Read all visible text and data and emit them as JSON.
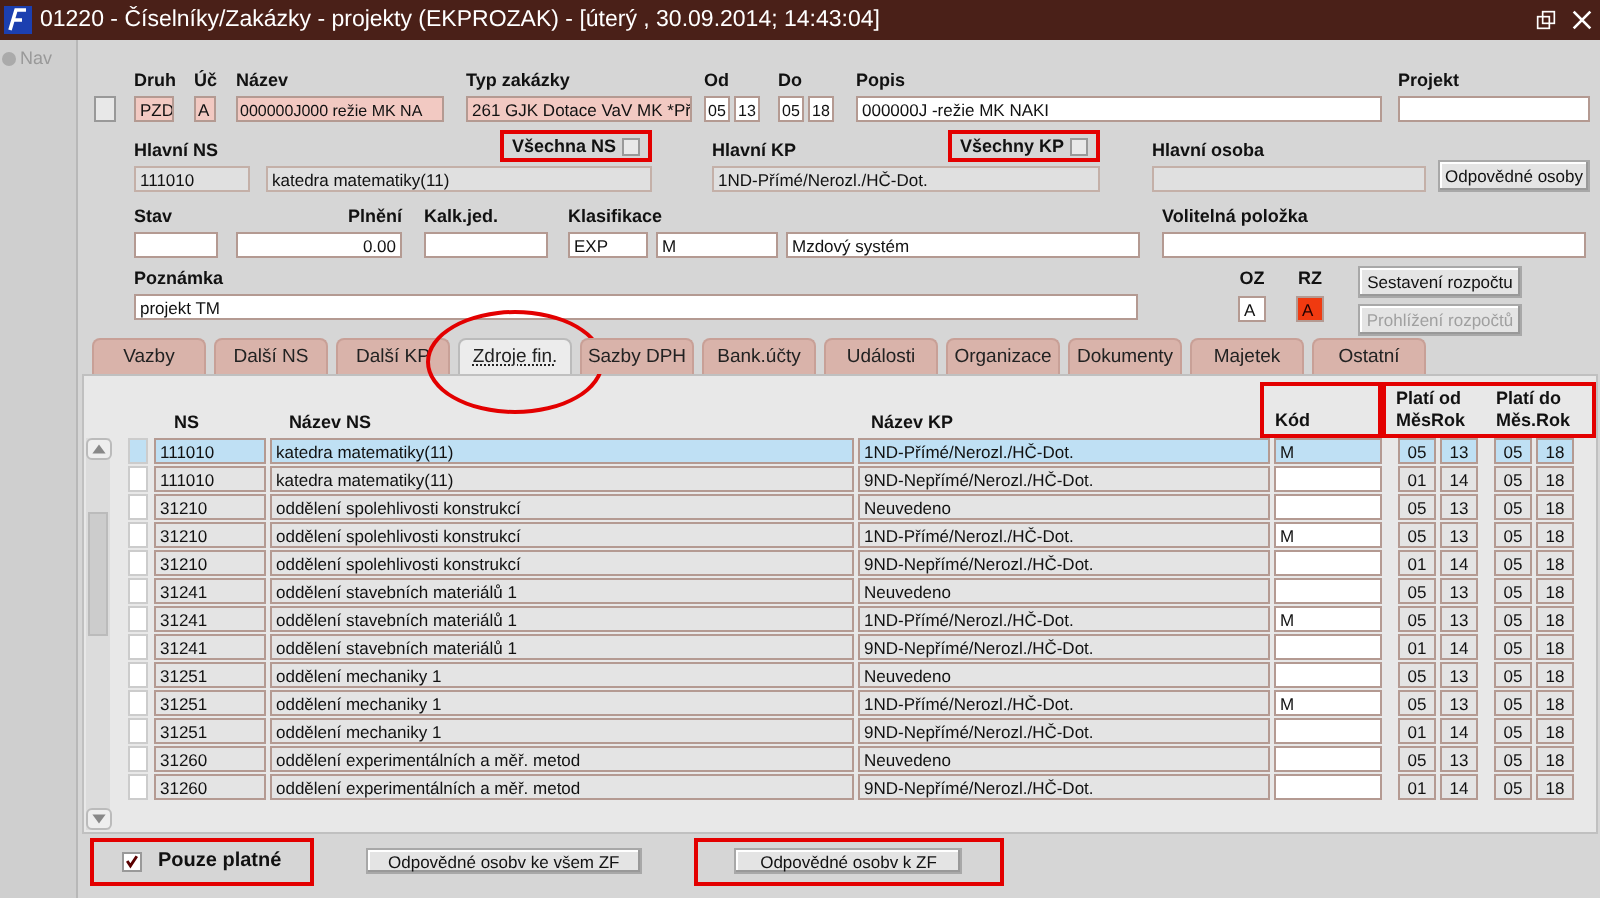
{
  "window": {
    "title": "01220 - Číselníky/Zakázky - projekty (EKPROZAK) - [úterý  , 30.09.2014; 14:43:04]"
  },
  "nav": {
    "label": "Nav",
    "disabled": true
  },
  "row_selector": {
    "checked": false
  },
  "druh": {
    "label": "Druh",
    "value": "PZD",
    "kind": "required"
  },
  "uc": {
    "label": "Úč",
    "value": "A",
    "kind": "required"
  },
  "nazev": {
    "label": "Název",
    "value": "000000J000 režie MK NA",
    "kind": "required"
  },
  "typ_zakazky": {
    "label": "Typ zakázky",
    "value": "261 GJK Dotace VaV MK *Př",
    "kind": "required"
  },
  "od": {
    "label": "Od",
    "month": "05",
    "year": "13"
  },
  "do": {
    "label": "Do",
    "month": "05",
    "year": "18"
  },
  "popis": {
    "label": "Popis",
    "value": "000000J -režie MK NAKI"
  },
  "projekt": {
    "label": "Projekt"
  },
  "hlavni_ns": {
    "label": "Hlavní NS",
    "code": "111010",
    "name": "katedra matematiky(11)",
    "kind": "readonly"
  },
  "vsechna_ns": {
    "label": "Všechna NS",
    "checked": false,
    "highlighted": true
  },
  "hlavni_kp": {
    "label": "Hlavní KP",
    "value": "1ND-Přímé/Nerozl./HČ-Dot.",
    "kind": "readonly"
  },
  "vsechny_kp": {
    "label": "Všechny KP",
    "checked": false,
    "highlighted": true
  },
  "hlavni_osoba": {
    "label": "Hlavní osoba",
    "kind": "readonly"
  },
  "odpovedne_osoby": {
    "label": "Odpovědné osoby",
    "disabled": false
  },
  "stav": {
    "label": "Stav"
  },
  "plneni": {
    "label": "Plnění",
    "value": "0.00"
  },
  "kalk_jed": {
    "label": "Kalk.jed."
  },
  "klasifikace": {
    "label": "Klasifikace",
    "values": [
      "EXP",
      "M",
      "Mzdový systém"
    ]
  },
  "volitelna_polozka": {
    "label": "Volitelná položka"
  },
  "poznamka": {
    "label": "Poznámka",
    "value": "projekt TM"
  },
  "oz": {
    "label": "OZ",
    "value": "A",
    "alert": false
  },
  "rz": {
    "label": "RZ",
    "value": "A",
    "alert": true
  },
  "sestaveni_rozpoctu": {
    "label": "Sestavení rozpočtu",
    "disabled": false
  },
  "prohlizeni_rozpoctu": {
    "label": "Prohlížení rozpočtů",
    "disabled": true
  },
  "tabs": [
    {
      "label": "Vazby",
      "selected": false,
      "highlighted": false
    },
    {
      "label": "Další NS",
      "selected": false,
      "highlighted": false
    },
    {
      "label": "Další KP",
      "selected": false,
      "highlighted": false
    },
    {
      "label": "Zdroje fin.",
      "selected": true,
      "highlighted": true
    },
    {
      "label": "Sazby DPH",
      "selected": false,
      "highlighted": false
    },
    {
      "label": "Bank.účty",
      "selected": false,
      "highlighted": false
    },
    {
      "label": "Události",
      "selected": false,
      "highlighted": false
    },
    {
      "label": "Organizace",
      "selected": false,
      "highlighted": false
    },
    {
      "label": "Dokumenty",
      "selected": false,
      "highlighted": false
    },
    {
      "label": "Majetek",
      "selected": false,
      "highlighted": false
    },
    {
      "label": "Ostatní",
      "selected": false,
      "highlighted": false
    }
  ],
  "table": {
    "columns": [
      {
        "label": "NS"
      },
      {
        "label": "Název NS"
      },
      {
        "label": "Název KP"
      },
      {
        "label": "Kód",
        "highlighted": true
      }
    ],
    "validity": {
      "highlighted": true,
      "groups": [
        {
          "label": "Platí od",
          "month": "Měs",
          "year": "Rok"
        },
        {
          "label": "Platí do",
          "month": "Měs.",
          "year": "Rok"
        }
      ]
    },
    "rows": [
      {
        "selected": true,
        "ns": "111010",
        "nazev_ns": "katedra matematiky(11)",
        "nazev_kp": "1ND-Přímé/Nerozl./HČ-Dot.",
        "kod": "M",
        "od_mes": "05",
        "od_rok": "13",
        "do_mes": "05",
        "do_rok": "18"
      },
      {
        "selected": false,
        "ns": "111010",
        "nazev_ns": "katedra matematiky(11)",
        "nazev_kp": "9ND-Nepřímé/Nerozl./HČ-Dot.",
        "od_mes": "01",
        "od_rok": "14",
        "do_mes": "05",
        "do_rok": "18"
      },
      {
        "selected": false,
        "ns": "31210",
        "nazev_ns": "oddělení spolehlivosti konstrukcí",
        "nazev_kp": "Neuvedeno",
        "od_mes": "05",
        "od_rok": "13",
        "do_mes": "05",
        "do_rok": "18"
      },
      {
        "selected": false,
        "ns": "31210",
        "nazev_ns": "oddělení spolehlivosti konstrukcí",
        "nazev_kp": "1ND-Přímé/Nerozl./HČ-Dot.",
        "kod": "M",
        "od_mes": "05",
        "od_rok": "13",
        "do_mes": "05",
        "do_rok": "18"
      },
      {
        "selected": false,
        "ns": "31210",
        "nazev_ns": "oddělení spolehlivosti konstrukcí",
        "nazev_kp": "9ND-Nepřímé/Nerozl./HČ-Dot.",
        "od_mes": "01",
        "od_rok": "14",
        "do_mes": "05",
        "do_rok": "18"
      },
      {
        "selected": false,
        "ns": "31241",
        "nazev_ns": "oddělení stavebních materiálů 1",
        "nazev_kp": "Neuvedeno",
        "od_mes": "05",
        "od_rok": "13",
        "do_mes": "05",
        "do_rok": "18"
      },
      {
        "selected": false,
        "ns": "31241",
        "nazev_ns": "oddělení stavebních materiálů 1",
        "nazev_kp": "1ND-Přímé/Nerozl./HČ-Dot.",
        "kod": "M",
        "od_mes": "05",
        "od_rok": "13",
        "do_mes": "05",
        "do_rok": "18"
      },
      {
        "selected": false,
        "ns": "31241",
        "nazev_ns": "oddělení stavebních materiálů 1",
        "nazev_kp": "9ND-Nepřímé/Nerozl./HČ-Dot.",
        "od_mes": "01",
        "od_rok": "14",
        "do_mes": "05",
        "do_rok": "18"
      },
      {
        "selected": false,
        "ns": "31251",
        "nazev_ns": "oddělení mechaniky 1",
        "nazev_kp": "Neuvedeno",
        "od_mes": "05",
        "od_rok": "13",
        "do_mes": "05",
        "do_rok": "18"
      },
      {
        "selected": false,
        "ns": "31251",
        "nazev_ns": "oddělení mechaniky 1",
        "nazev_kp": "1ND-Přímé/Nerozl./HČ-Dot.",
        "kod": "M",
        "od_mes": "05",
        "od_rok": "13",
        "do_mes": "05",
        "do_rok": "18"
      },
      {
        "selected": false,
        "ns": "31251",
        "nazev_ns": "oddělení mechaniky 1",
        "nazev_kp": "9ND-Nepřímé/Nerozl./HČ-Dot.",
        "od_mes": "01",
        "od_rok": "14",
        "do_mes": "05",
        "do_rok": "18"
      },
      {
        "selected": false,
        "ns": "31260",
        "nazev_ns": "oddělení experimentálních a měř. metod",
        "nazev_kp": "Neuvedeno",
        "od_mes": "05",
        "od_rok": "13",
        "do_mes": "05",
        "do_rok": "18"
      },
      {
        "selected": false,
        "ns": "31260",
        "nazev_ns": "oddělení experimentálních a měř. metod",
        "nazev_kp": "9ND-Nepřímé/Nerozl./HČ-Dot.",
        "od_mes": "01",
        "od_rok": "14",
        "do_mes": "05",
        "do_rok": "18"
      }
    ]
  },
  "pouze_platne": {
    "label": "Pouze platné",
    "checked": true,
    "highlighted": true
  },
  "footer_buttons": [
    {
      "label": "Odpovědné osobv ke všem ZF",
      "highlighted": false
    },
    {
      "label": "Odpovědné osobv k ZF",
      "highlighted": true
    }
  ]
}
